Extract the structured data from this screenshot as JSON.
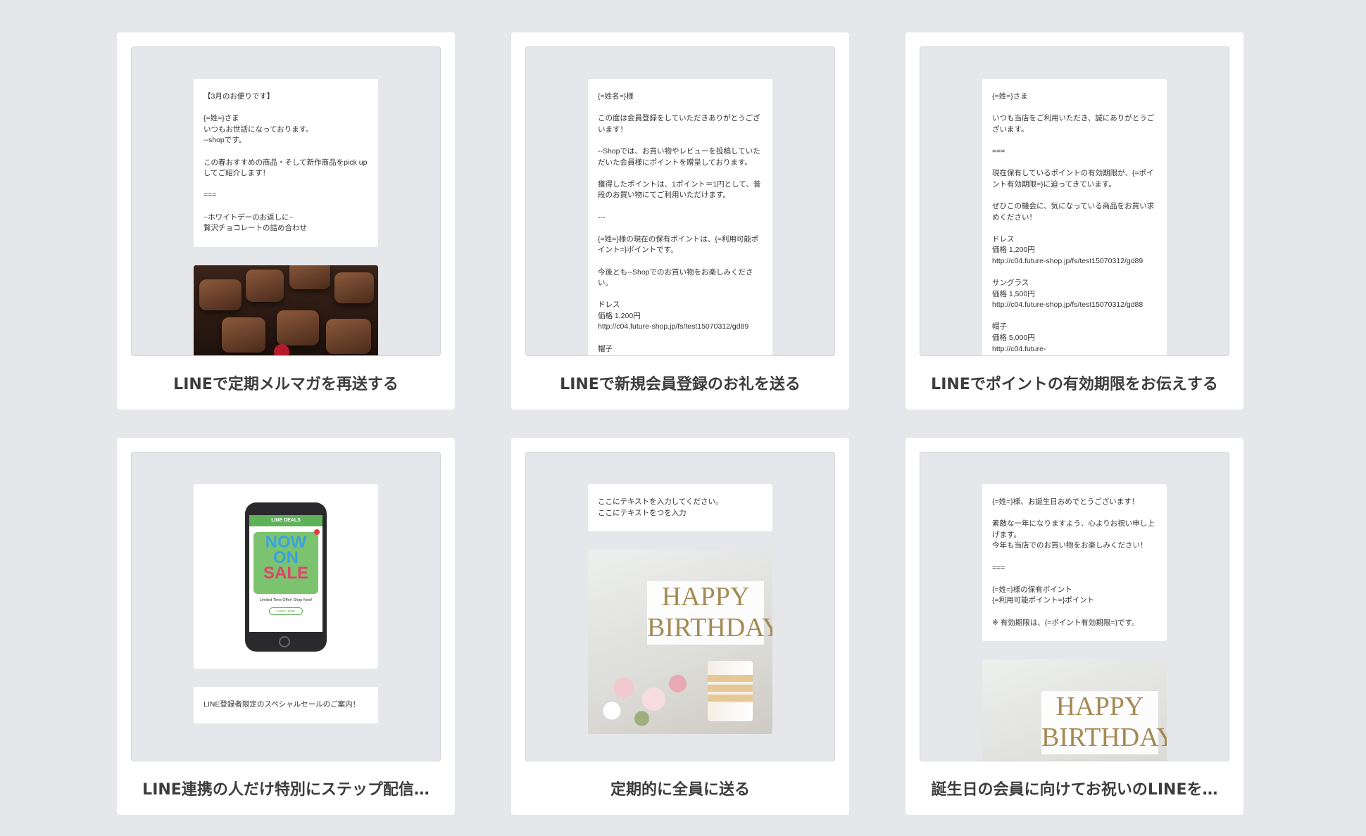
{
  "cards": [
    {
      "title": "LINEで定期メルマガを再送する",
      "message": "【3月のお便りです】\n\n{=姓=}さま\nいつもお世話になっております。\n--shopです。\n\nこの春おすすめの商品・そして新作商品をpick upしてご紹介します！\n\n===\n\n~ホワイトデーのお返しに~\n贅沢チョコレートの詰め合わせ"
    },
    {
      "title": "LINEで新規会員登録のお礼を送る",
      "message": "{=姓名=}様\n\nこの度は会員登録をしていただきありがとうございます！\n\n--Shopでは、お買い物やレビューを投稿していただいた会員様にポイントを贈呈しております。\n\n獲得したポイントは、1ポイント＝1円として、普段のお買い物にてご利用いただけます。\n\n---\n\n{=姓=}様の現在の保有ポイントは、{=利用可能ポイント=}ポイントです。\n\n今後とも--Shopでのお買い物をお楽しみください。\n\nドレス\n価格 1,200円\nhttp://c04.future-shop.jp/fs/test15070312/gd89\n\n帽子"
    },
    {
      "title": "LINEでポイントの有効期限をお伝えする",
      "message": "{=姓=}さま\n\nいつも当店をご利用いただき、誠にありがとうございます。\n\n===\n\n現在保有しているポイントの有効期限が、{=ポイント有効期限=}に迫ってきています。\n\nぜひこの機会に、気になっている商品をお買い求めください！\n\nドレス\n価格 1,200円\nhttp://c04.future-shop.jp/fs/test15070312/gd89\n\nサングラス\n価格 1,500円\nhttp://c04.future-shop.jp/fs/test15070312/gd88\n\n帽子\n価格 5,000円\nhttp://c04.future-"
    },
    {
      "title": "LINE連携の人だけ特別にステップ配信…",
      "message": "LINE登録者限定のスペシャルセールのご案内！",
      "phone": {
        "header": "LINE DEALS",
        "sale_line1": "NOW",
        "sale_line2": "ON",
        "sale_line3": "SALE",
        "small_text": "Limited Time Offer! Shop Now!",
        "button": "SHOP HERE"
      }
    },
    {
      "title": "定期的に全員に送る",
      "message": "ここにテキストを入力してください。\nここにテキストをつを入力",
      "image_line1": "HAPPY",
      "image_line2": "BIRTHDAY"
    },
    {
      "title": "誕生日の会員に向けてお祝いのLINEを…",
      "message": "{=姓=}様、お誕生日おめでとうございます！\n\n素敵な一年になりますよう、心よりお祝い申し上げます。\n今年も当店でのお買い物をお楽しみください！\n\n===\n\n{=姓=}様の保有ポイント\n{=利用可能ポイント=}ポイント\n\n※ 有効期限は、{=ポイント有効期限=}です。",
      "image_line1": "HAPPY",
      "image_line2": "BIRTHDAY"
    }
  ]
}
